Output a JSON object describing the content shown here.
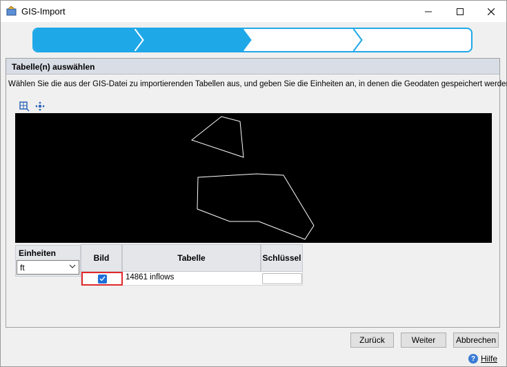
{
  "window": {
    "title": "GIS-Import"
  },
  "wizard": {
    "steps_total": 4,
    "steps_completed": 2,
    "accent": "#1fa8e8"
  },
  "section": {
    "header": "Tabelle(n) auswählen",
    "description": "Wählen Sie die aus der GIS-Datei zu importierenden Tabellen aus, und geben Sie die Einheiten an, in denen die Geodaten gespeichert werden"
  },
  "toolbar": {
    "zoom_icon": "zoom-extent-icon",
    "pan_icon": "pan-icon"
  },
  "units": {
    "label": "Einheiten",
    "selected": "ft"
  },
  "grid": {
    "columns": [
      "Bild",
      "Tabelle",
      "Schlüssel"
    ],
    "rows": [
      {
        "bild": true,
        "tabelle": "14861 inflows",
        "schluessel": ""
      }
    ]
  },
  "buttons": {
    "back": "Zurück",
    "next": "Weiter",
    "cancel": "Abbrechen",
    "help": "Hilfe"
  }
}
